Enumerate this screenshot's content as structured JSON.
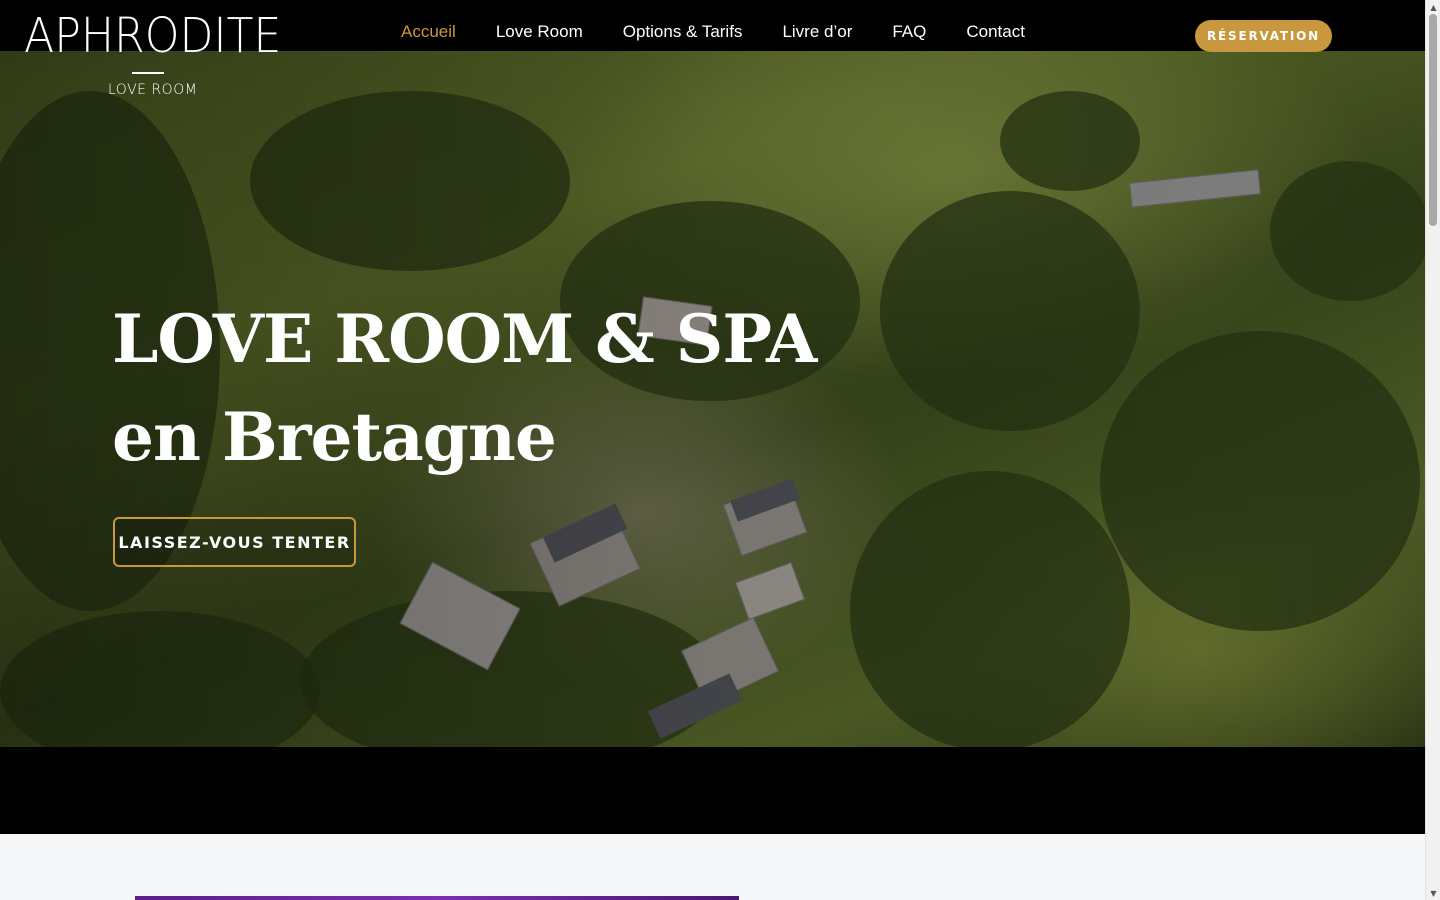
{
  "brand": {
    "name": "APHRODITE",
    "tagline": "LOVE ROOM"
  },
  "nav": {
    "items": [
      {
        "label": "Accueil",
        "active": true
      },
      {
        "label": "Love Room",
        "active": false
      },
      {
        "label": "Options & Tarifs",
        "active": false
      },
      {
        "label": "Livre d’or",
        "active": false
      },
      {
        "label": "FAQ",
        "active": false
      },
      {
        "label": "Contact",
        "active": false
      }
    ],
    "reserve_label": "RÉSERVATION"
  },
  "hero": {
    "title_line1": "LOVE ROOM & SPA",
    "title_line2": "en Bretagne",
    "cta_label": "LAISSEZ-VOUS TENTER"
  },
  "colors": {
    "accent": "#c9973d",
    "header_bg": "#000000",
    "section_bg": "#f6f7f9"
  },
  "icons": {
    "scroll_up": "chevron-up-icon",
    "scroll_down": "chevron-down-icon"
  }
}
